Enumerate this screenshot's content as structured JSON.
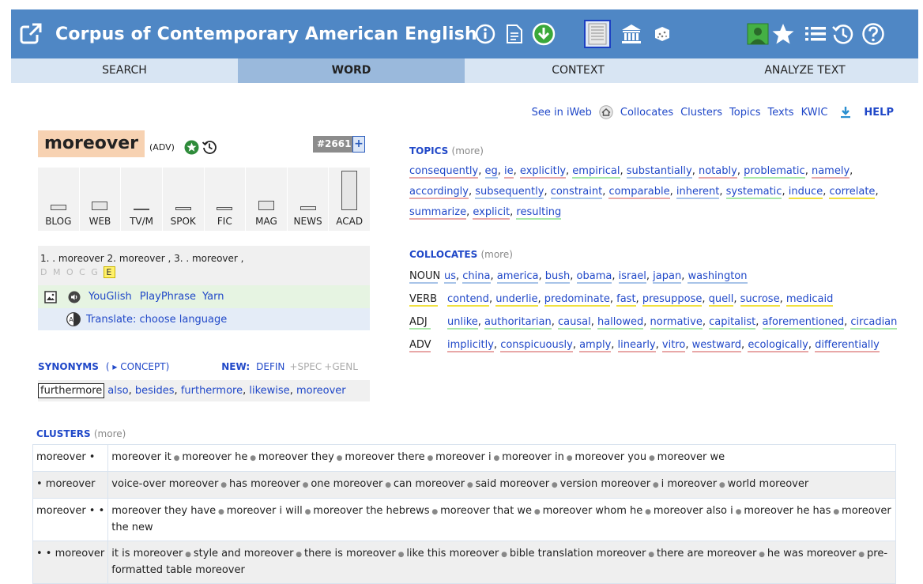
{
  "header": {
    "title": "Corpus of Contemporary American English",
    "bg_color": "#4f87c5",
    "icons": [
      "external-link-icon",
      "info-icon",
      "document-icon",
      "download-icon",
      "grid-icon",
      "institution-icon",
      "dice-icon",
      "user-icon",
      "star-icon",
      "list-icon",
      "history-icon",
      "help-icon"
    ]
  },
  "tabs": [
    {
      "label": "SEARCH"
    },
    {
      "label": "WORD"
    },
    {
      "label": "CONTEXT"
    },
    {
      "label": "ANALYZE TEXT"
    }
  ],
  "toplinks": {
    "see_in_iweb": "See in iWeb",
    "collocates": "Collocates",
    "clusters": "Clusters",
    "topics": "Topics",
    "texts": "Texts",
    "kwic": "KWIC",
    "help": "HELP"
  },
  "word": {
    "text": "moreover",
    "pos": "(ADV)",
    "rank": "#2661",
    "rank_plus": "+"
  },
  "genres": [
    {
      "label": "BLOG",
      "level": 0.13
    },
    {
      "label": "WEB",
      "level": 0.22
    },
    {
      "label": "TV/M",
      "level": 0.04
    },
    {
      "label": "SPOK",
      "level": 0.08
    },
    {
      "label": "FIC",
      "level": 0.08
    },
    {
      "label": "MAG",
      "level": 0.24
    },
    {
      "label": "NEWS",
      "level": 0.1
    },
    {
      "label": "ACAD",
      "level": 1.0
    }
  ],
  "variants": {
    "text": "1. . moreover 2. moreover , 3. . moreover ,",
    "letters": "D M O C G",
    "selected_letter": "E"
  },
  "media": {
    "youglish": "YouGlish",
    "playphrase": "PlayPhrase",
    "yarn": "Yarn"
  },
  "translate": "Translate: choose language",
  "synonyms": {
    "title": "SYNONYMS",
    "concept": "( ▸ CONCEPT)",
    "new_label": "NEW:",
    "defin": "DEFIN",
    "spec": "+SPEC",
    "genl": "+GENL",
    "boxed": "furthermore",
    "list": [
      "also",
      "besides",
      "furthermore",
      "likewise",
      "moreover"
    ]
  },
  "topics": {
    "title": "TOPICS",
    "more": "(more)",
    "words": [
      {
        "w": "consequently",
        "c": "#e8a8a8"
      },
      {
        "w": "eg",
        "c": "#a8c4e8"
      },
      {
        "w": "ie",
        "c": "#e8a8a8"
      },
      {
        "w": "explicitly",
        "c": "#e8a8a8"
      },
      {
        "w": "empirical",
        "c": "#a8e8a8"
      },
      {
        "w": "substantially",
        "c": "#a8c4e8"
      },
      {
        "w": "notably",
        "c": "#e8a8a8"
      },
      {
        "w": "problematic",
        "c": "#a8e8a8"
      },
      {
        "w": "namely",
        "c": "#e8a8a8"
      },
      {
        "w": "accordingly",
        "c": "#e8a8a8"
      },
      {
        "w": "subsequently",
        "c": "#a8c4e8"
      },
      {
        "w": "constraint",
        "c": "#a8c4e8"
      },
      {
        "w": "comparable",
        "c": "#e8a8a8"
      },
      {
        "w": "inherent",
        "c": "#a8c4e8"
      },
      {
        "w": "systematic",
        "c": "#a8e8a8"
      },
      {
        "w": "induce",
        "c": "#f0e040"
      },
      {
        "w": "correlate",
        "c": "#f0e040"
      },
      {
        "w": "summarize",
        "c": "#e8a8a8"
      },
      {
        "w": "explicit",
        "c": "#e8a8a8"
      },
      {
        "w": "resulting",
        "c": "#a8e8a8"
      }
    ]
  },
  "collocates": {
    "title": "COLLOCATES",
    "more": "(more)",
    "rows": [
      {
        "pos": "NOUN",
        "pos_color": "#a8c4e8",
        "words": [
          {
            "w": "us",
            "c": "#a8c4e8"
          },
          {
            "w": "china",
            "c": "#a8c4e8"
          },
          {
            "w": "america",
            "c": "#a8c4e8"
          },
          {
            "w": "bush",
            "c": "#a8c4e8"
          },
          {
            "w": "obama",
            "c": "#a8c4e8"
          },
          {
            "w": "israel",
            "c": "#a8c4e8"
          },
          {
            "w": "japan",
            "c": "#a8c4e8"
          },
          {
            "w": "washington",
            "c": "#a8c4e8"
          }
        ]
      },
      {
        "pos": "VERB",
        "pos_color": "#f0e040",
        "words": [
          {
            "w": "contend",
            "c": "#f0e040"
          },
          {
            "w": "underlie",
            "c": "#f0e040"
          },
          {
            "w": "predominate",
            "c": "#f0e040"
          },
          {
            "w": "fast",
            "c": "#f0e040"
          },
          {
            "w": "presuppose",
            "c": "#f0e040"
          },
          {
            "w": "quell",
            "c": "#f0e040"
          },
          {
            "w": "sucrose",
            "c": "#f0e040"
          },
          {
            "w": "medicaid",
            "c": "#f0e040"
          }
        ]
      },
      {
        "pos": "ADJ",
        "pos_color": "#a8e8a8",
        "words": [
          {
            "w": "unlike",
            "c": "#a8e8a8"
          },
          {
            "w": "authoritarian",
            "c": "#a8e8a8"
          },
          {
            "w": "causal",
            "c": "#a8e8a8"
          },
          {
            "w": "hallowed",
            "c": "#a8e8a8"
          },
          {
            "w": "normative",
            "c": "#a8e8a8"
          },
          {
            "w": "capitalist",
            "c": "#a8e8a8"
          },
          {
            "w": "aforementioned",
            "c": "#a8e8a8"
          },
          {
            "w": "circadian",
            "c": "#a8e8a8"
          }
        ]
      },
      {
        "pos": "ADV",
        "pos_color": "#e8a8a8",
        "words": [
          {
            "w": "implicitly",
            "c": "#e8a8a8"
          },
          {
            "w": "conspicuously",
            "c": "#e8a8a8"
          },
          {
            "w": "amply",
            "c": "#e8a8a8"
          },
          {
            "w": "linearly",
            "c": "#e8a8a8"
          },
          {
            "w": "vitro",
            "c": "#e8a8a8"
          },
          {
            "w": "westward",
            "c": "#e8a8a8"
          },
          {
            "w": "ecologically",
            "c": "#e8a8a8"
          },
          {
            "w": "differentially",
            "c": "#e8a8a8"
          }
        ]
      }
    ]
  },
  "clusters": {
    "title": "CLUSTERS",
    "more": "(more)",
    "rows": [
      {
        "pattern": "moreover •",
        "items": [
          "moreover it",
          "moreover he",
          "moreover they",
          "moreover there",
          "moreover i",
          "moreover in",
          "moreover you",
          "moreover we"
        ]
      },
      {
        "pattern": "• moreover",
        "items": [
          "voice-over moreover",
          "has moreover",
          "one moreover",
          "can moreover",
          "said moreover",
          "version moreover",
          "i moreover",
          "world moreover"
        ]
      },
      {
        "pattern": "moreover • •",
        "items": [
          "moreover they have",
          "moreover i will",
          "moreover the hebrews",
          "moreover that we",
          "moreover whom he",
          "moreover also i",
          "moreover he has",
          "moreover the new"
        ]
      },
      {
        "pattern": "• • moreover",
        "items": [
          "it is moreover",
          "style and moreover",
          "there is moreover",
          "like this moreover",
          "bible translation moreover",
          "there are moreover",
          "he was moreover",
          "pre-formatted table moreover"
        ]
      }
    ]
  }
}
